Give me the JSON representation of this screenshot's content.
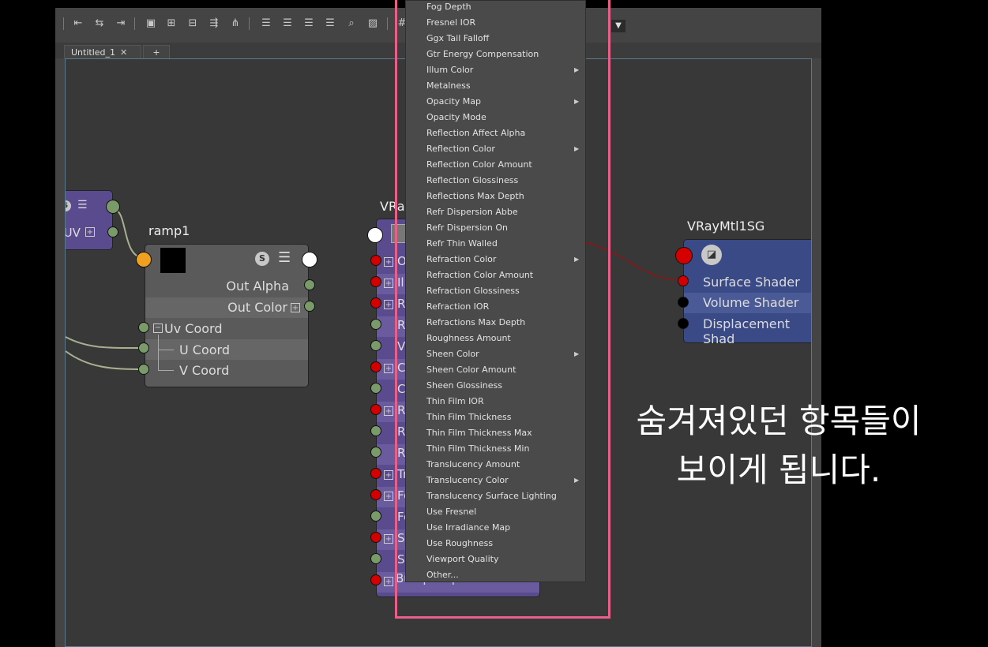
{
  "tabs": {
    "active_label": "Untitled_1",
    "add_label": "+"
  },
  "nodes": {
    "left_partial": {
      "attr": "t UV"
    },
    "ramp": {
      "title": "ramp1",
      "out_alpha": "Out Alpha",
      "out_color": "Out Color",
      "uv_coord": "Uv Coord",
      "u_coord": "U Coord",
      "v_coord": "V Coord"
    },
    "vraymtl": {
      "title": "VRa",
      "bottom_attr": "Bump Map",
      "rows": [
        "O",
        "Ill",
        "Re",
        "Re",
        "V",
        "Co",
        "Co",
        "Re",
        "Re",
        "Re",
        "Tr",
        "Fo",
        "Fo",
        "Sh",
        "Sh"
      ]
    },
    "sg": {
      "title": "VRayMtl1SG",
      "surface": "Surface Shader",
      "volume": "Volume Shader",
      "displacement": "Displacement Shad"
    }
  },
  "menu": {
    "items": [
      "Fog Depth",
      "Fresnel IOR",
      "Ggx Tail Falloff",
      "Gtr Energy Compensation",
      "Illum Color",
      "Metalness",
      "Opacity Map",
      "Opacity Mode",
      "Reflection Affect Alpha",
      "Reflection Color",
      "Reflection Color Amount",
      "Reflection Glossiness",
      "Reflections Max Depth",
      "Refr Dispersion Abbe",
      "Refr Dispersion On",
      "Refr Thin Walled",
      "Refraction Color",
      "Refraction Color Amount",
      "Refraction Glossiness",
      "Refraction IOR",
      "Refractions Max Depth",
      "Roughness Amount",
      "Sheen Color",
      "Sheen Color Amount",
      "Sheen Glossiness",
      "Thin Film IOR",
      "Thin Film Thickness",
      "Thin Film Thickness Max",
      "Thin Film Thickness Min",
      "Translucency Amount",
      "Translucency Color",
      "Translucency Surface Lighting",
      "Use Fresnel",
      "Use Irradiance Map",
      "Use Roughness",
      "Viewport Quality",
      "Other..."
    ],
    "submenu_items": [
      "Illum Color",
      "Opacity Map",
      "Reflection Color",
      "Refraction Color",
      "Sheen Color",
      "Translucency Color"
    ]
  },
  "caption": {
    "line1": "숨겨져있던 항목들이",
    "line2": "보이게 됩니다."
  },
  "colors": {
    "accent_highlight": "#e8608a",
    "port_red": "#d40000",
    "port_green": "#7a9a6a",
    "port_orange": "#f0a020",
    "node_purple": "#5a4a8e",
    "node_blue": "#3a4a86"
  }
}
